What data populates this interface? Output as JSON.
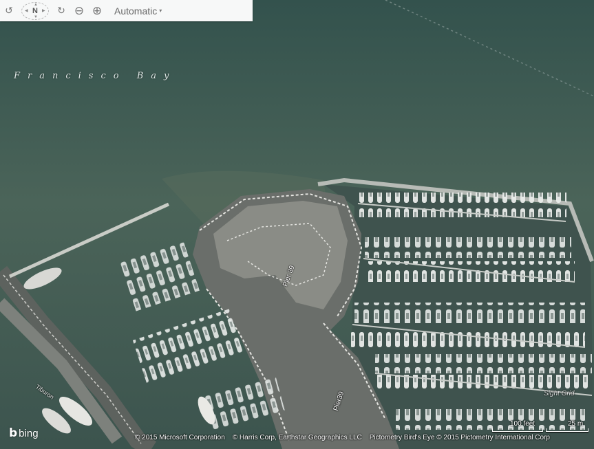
{
  "toolbar": {
    "buttons": [
      {
        "name": "rotate-left-icon",
        "glyph": "↺"
      },
      {
        "name": "compass-icon",
        "glyph": "N"
      },
      {
        "name": "rotate-right-icon",
        "glyph": "↻"
      },
      {
        "name": "zoom-out-icon",
        "glyph": "⊖"
      },
      {
        "name": "zoom-in-icon",
        "glyph": "⊕"
      }
    ],
    "compass_letter": "N",
    "map_mode_label": "Automatic",
    "map_mode_caret": "▾"
  },
  "map": {
    "water_label": "Francisco Bay",
    "road_labels": [
      "Pier 39",
      "Pier39",
      "Tiburon",
      "Sight Grid"
    ]
  },
  "footer": {
    "logo_text": "bing",
    "logo_glyph": "b",
    "attributions": [
      "© 2015 Microsoft Corporation",
      "© Harris Corp, Earthstar Geographics LLC",
      "Pictometry Bird's Eye © 2015 Pictometry International Corp"
    ],
    "scale_imperial": "100 feet",
    "scale_metric": "25 m"
  },
  "colors": {
    "water_deep": "#3e5853",
    "water_shallow": "#55685a",
    "marina_water": "#40544f",
    "pier": "#8a8a8a",
    "toolbar_bg": "#ffffff"
  }
}
